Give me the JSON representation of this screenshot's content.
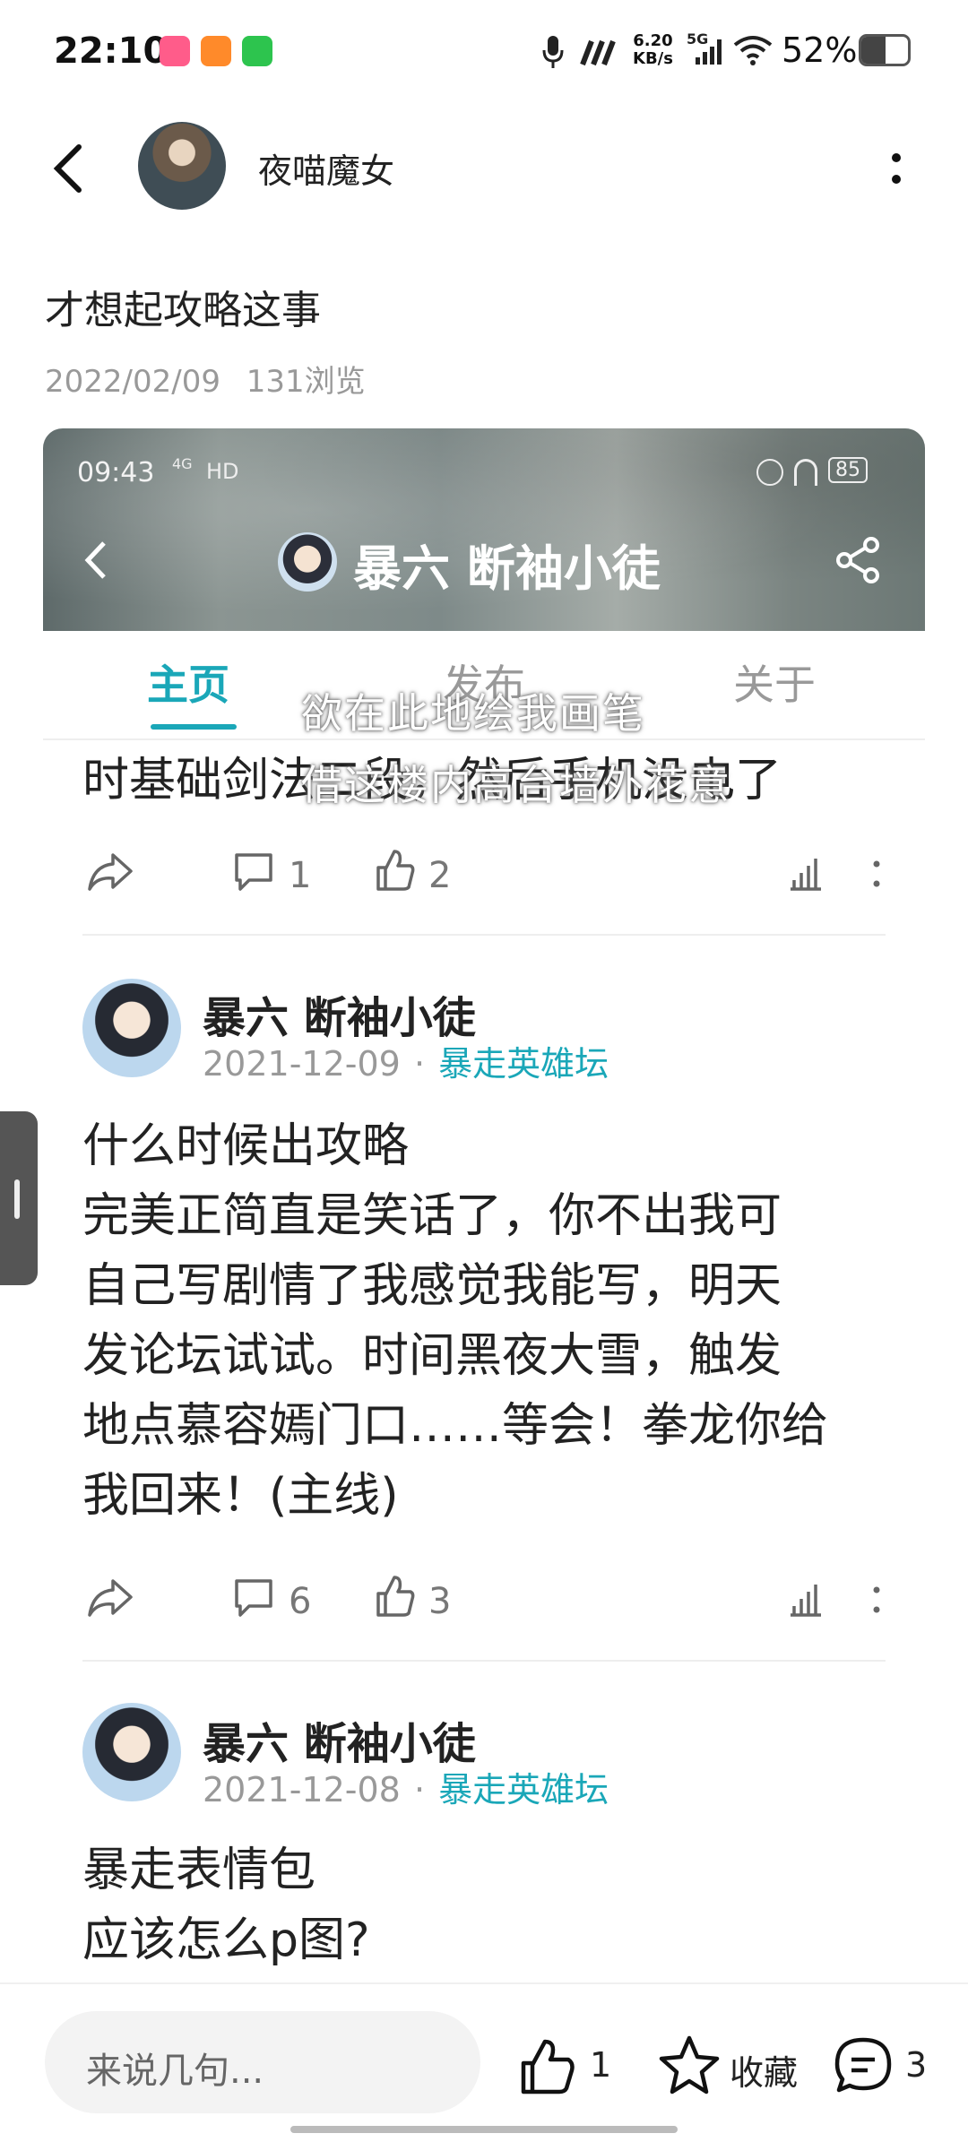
{
  "status_bar": {
    "time": "22:10",
    "net_speed_top": "6.20",
    "net_speed_unit": "KB/s",
    "signal_label": "5G",
    "battery": "52%",
    "battery_level": 0.52
  },
  "header": {
    "author": "夜喵魔女"
  },
  "post": {
    "title": "才想起攻略这事",
    "date": "2022/02/09",
    "views": "131浏览"
  },
  "embedded_shot": {
    "time": "09:43",
    "signal": "4G",
    "hd": "HD",
    "battery": "85",
    "title": "暴六 断袖小徒",
    "tabs": [
      "主页",
      "发布",
      "关于"
    ],
    "overlay_line1": "欲在此地绘我画笔",
    "overlay_line2": "借这楼内高台墙外花意"
  },
  "feed": {
    "partial_text": "时基础剑法二段，然后手机没电了",
    "item0": {
      "comments": "1",
      "likes": "2"
    },
    "item1": {
      "name": "暴六 断袖小徒",
      "date": "2021-12-09",
      "sep": "·",
      "forum": "暴走英雄坛",
      "line1": "什么时候出攻略",
      "line2": "完美正简直是笑话了，你不出我可",
      "line3": "自己写剧情了我感觉我能写，明天",
      "line4": "发论坛试试。时间黑夜大雪，触发",
      "line5": "地点慕容嫣门口……等会！拳龙你给",
      "line6": "我回来！(主线)",
      "comments": "6",
      "likes": "3"
    },
    "item2": {
      "name": "暴六 断袖小徒",
      "date": "2021-12-08",
      "sep": "·",
      "forum": "暴走英雄坛",
      "line1": "暴走表情包",
      "line2": "应该怎么p图?"
    }
  },
  "bottom_bar": {
    "placeholder": "来说几句...",
    "likes": "1",
    "favorite": "收藏",
    "comments": "3"
  },
  "colors": {
    "accent": "#1aa7b8",
    "muted": "#999999"
  }
}
